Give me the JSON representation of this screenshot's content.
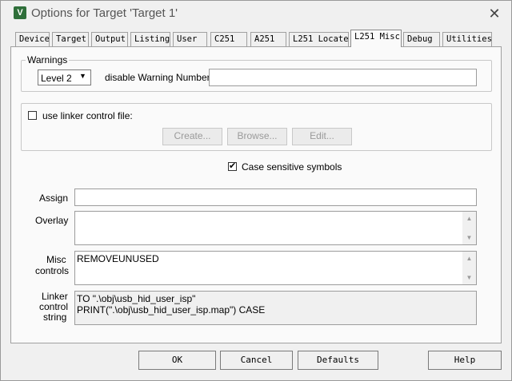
{
  "window": {
    "title": "Options for Target 'Target 1'",
    "app_icon_letter": "V"
  },
  "tabs": [
    {
      "label": "Device"
    },
    {
      "label": "Target"
    },
    {
      "label": "Output"
    },
    {
      "label": "Listing"
    },
    {
      "label": "User"
    },
    {
      "label": "C251"
    },
    {
      "label": "A251"
    },
    {
      "label": "L251 Locate"
    },
    {
      "label": "L251 Misc"
    },
    {
      "label": "Debug"
    },
    {
      "label": "Utilities"
    }
  ],
  "warnings": {
    "group_label": "Warnings",
    "level_value": "Level 2",
    "disable_label": "disable Warning Numbers:",
    "disable_value": ""
  },
  "linker_control": {
    "checkbox_label": "use linker control file:",
    "create_label": "Create...",
    "browse_label": "Browse...",
    "edit_label": "Edit..."
  },
  "case_sensitive": {
    "label": "Case sensitive symbols",
    "checked": true
  },
  "fields": {
    "assign_label": "Assign",
    "assign_value": "",
    "overlay_label": "Overlay",
    "overlay_value": "",
    "misc_label_1": "Misc",
    "misc_label_2": "controls",
    "misc_value": "REMOVEUNUSED",
    "linker_label_1": "Linker",
    "linker_label_2": "control",
    "linker_label_3": "string",
    "linker_line_1": "TO \".\\obj\\usb_hid_user_isp\"",
    "linker_line_2": "PRINT(\".\\obj\\usb_hid_user_isp.map\") CASE"
  },
  "buttons": {
    "ok": "OK",
    "cancel": "Cancel",
    "defaults": "Defaults",
    "help": "Help"
  }
}
